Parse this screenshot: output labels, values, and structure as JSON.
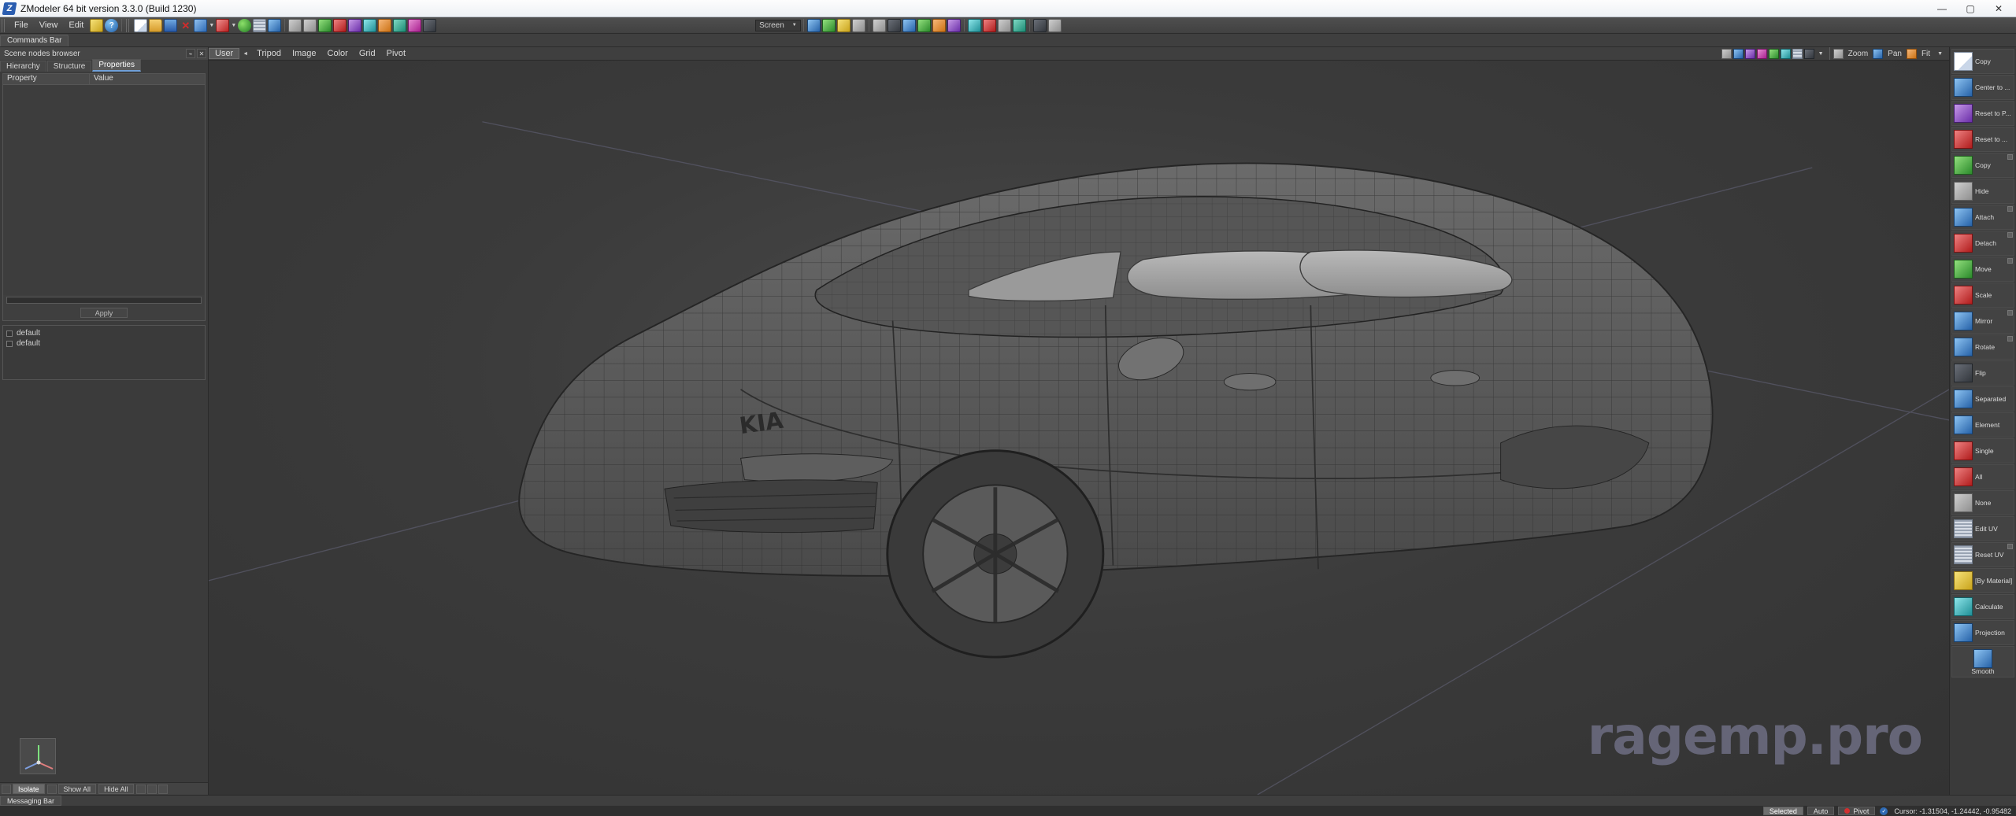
{
  "window": {
    "title": "ZModeler 64 bit version 3.3.0 (Build 1230)",
    "app_icon": "zmodeler-logo-icon",
    "minimize": "—",
    "maximize": "▢",
    "close": "✕"
  },
  "menu": {
    "items": [
      "File",
      "View",
      "Edit"
    ],
    "icons": [
      "preferences-icon",
      "help-icon"
    ]
  },
  "toolbar": {
    "screen_label": "Screen",
    "file_group": [
      "new-document-icon",
      "open-folder-icon",
      "save-disk-icon",
      "close-red-x-icon",
      "import-icon",
      "export-icon",
      "globe-icon",
      "texture-grid-icon",
      "arrow-icon"
    ],
    "zoom_label": "Zoom",
    "pan_label": "Pan",
    "fit_label": "Fit"
  },
  "commands_bar": {
    "tab_label": "Commands Bar"
  },
  "left_panel": {
    "dock_title": "Scene nodes browser",
    "dock_buttons": [
      "pin-icon",
      "close-icon"
    ],
    "tabs": [
      {
        "label": "Hierarchy",
        "active": false
      },
      {
        "label": "Structure",
        "active": false
      },
      {
        "label": "Properties",
        "active": true
      }
    ],
    "columns": [
      "Property",
      "Value"
    ],
    "rows": [],
    "apply_label": "Apply",
    "layers": [
      {
        "label": "default",
        "checked": false
      },
      {
        "label": "default",
        "checked": false
      }
    ],
    "bottom_buttons": [
      "Isolate",
      "Show All",
      "Hide All"
    ],
    "axis_gizmo": "axis-gizmo-icon"
  },
  "viewport": {
    "menu": [
      "User",
      "Tripod",
      "Image",
      "Color",
      "Grid",
      "Pivot"
    ],
    "selected_menu": "User",
    "collapse_caret": "◄",
    "render_icons": [
      "wireframe-icon",
      "solid-icon",
      "textured-icon",
      "lines-icon",
      "material-icon",
      "shaded-icon",
      "uv-icon",
      "flat-icon"
    ],
    "nav_buttons": [
      {
        "label": "Zoom",
        "icon": "magnifier-icon"
      },
      {
        "label": "Pan",
        "icon": "hand-icon"
      },
      {
        "label": "Fit",
        "icon": "fit-icon"
      }
    ],
    "watermark": "ragemp.pro",
    "model": "car-wireframe-mesh"
  },
  "right_toolbar": {
    "items": [
      {
        "label": "Copy",
        "icon": "copy-hand-icon",
        "expand": false,
        "tall": false
      },
      {
        "label": "Center to ...",
        "icon": "center-to-icon",
        "expand": false,
        "tall": false
      },
      {
        "label": "Reset to P...",
        "icon": "reset-to-parent-icon",
        "expand": false,
        "tall": false
      },
      {
        "label": "Reset to ...",
        "icon": "reset-to-icon",
        "expand": false,
        "tall": false
      },
      {
        "label": "Copy",
        "icon": "copy-object-icon",
        "expand": true,
        "tall": false
      },
      {
        "label": "Hide",
        "icon": "hide-icon",
        "expand": false,
        "tall": false
      },
      {
        "label": "Attach",
        "icon": "attach-icon",
        "expand": true,
        "tall": false
      },
      {
        "label": "Detach",
        "icon": "detach-icon",
        "expand": true,
        "tall": false
      },
      {
        "label": "Move",
        "icon": "move-arrows-icon",
        "expand": true,
        "tall": false
      },
      {
        "label": "Scale",
        "icon": "scale-icon",
        "expand": false,
        "tall": false
      },
      {
        "label": "Mirror",
        "icon": "mirror-icon",
        "expand": true,
        "tall": false
      },
      {
        "label": "Rotate",
        "icon": "rotate-icon",
        "expand": true,
        "tall": false
      },
      {
        "label": "Flip",
        "icon": "flip-icon",
        "expand": false,
        "tall": false
      },
      {
        "label": "Separated",
        "icon": "separated-icon",
        "expand": false,
        "tall": false
      },
      {
        "label": "Element",
        "icon": "element-icon",
        "expand": false,
        "tall": false
      },
      {
        "label": "Single",
        "icon": "single-icon",
        "expand": false,
        "tall": false
      },
      {
        "label": "All",
        "icon": "all-icon",
        "expand": false,
        "tall": false
      },
      {
        "label": "None",
        "icon": "none-icon",
        "expand": false,
        "tall": false
      },
      {
        "label": "Edit UV",
        "icon": "edit-uv-icon",
        "expand": false,
        "tall": false
      },
      {
        "label": "Reset UV",
        "icon": "reset-uv-icon",
        "expand": true,
        "tall": false
      },
      {
        "label": "[By Material]",
        "icon": "by-material-icon",
        "expand": false,
        "tall": false
      },
      {
        "label": "Calculate",
        "icon": "calculate-icon",
        "expand": false,
        "tall": false
      },
      {
        "label": "Projection",
        "icon": "projection-icon",
        "expand": false,
        "tall": false
      },
      {
        "label": "Smooth",
        "icon": "smooth-icon",
        "expand": false,
        "tall": true
      }
    ]
  },
  "message_bar": {
    "tab_label": "Messaging Bar"
  },
  "status_bar": {
    "selected_label": "Selected",
    "auto_label": "Auto",
    "pivot_label": "Pivot",
    "check_icon": "check-icon",
    "cursor": "Cursor: -1.31504, -1.24442, -0.95482"
  },
  "colors": {
    "accent": "#6f9fd8",
    "panel": "#3b3b3b",
    "viewport_bg": "#3b3b3b",
    "watermark": "#6e6e83",
    "status_red": "#d03030"
  }
}
